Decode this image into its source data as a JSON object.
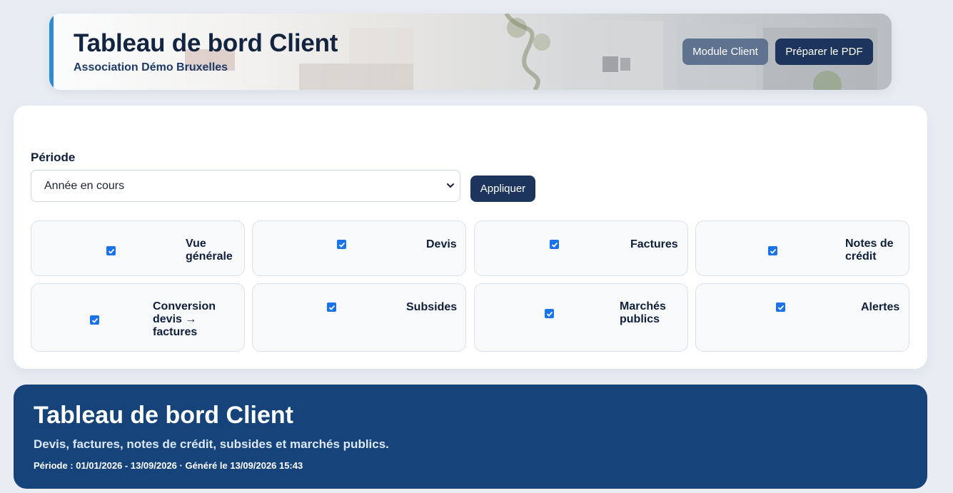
{
  "header": {
    "title": "Tableau de bord Client",
    "subtitle": "Association Démo Bruxelles",
    "buttons": {
      "client_label": "Module Client",
      "pdf_label": "Préparer le PDF"
    }
  },
  "filters": {
    "period_label": "Période",
    "period_selected": "Année en cours",
    "apply_label": "Appliquer",
    "sections": [
      {
        "label": "Vue\ngénérale",
        "checked": true
      },
      {
        "label": "Devis",
        "checked": true
      },
      {
        "label": "Factures",
        "checked": true
      },
      {
        "label": "Notes de\ncrédit",
        "checked": true
      },
      {
        "label": "Conversion\ndevis →\nfactures",
        "checked": true
      },
      {
        "label": "Subsides",
        "checked": true
      },
      {
        "label": "Marchés\npublics",
        "checked": true
      },
      {
        "label": "Alertes",
        "checked": true
      }
    ]
  },
  "banner": {
    "title": "Tableau de bord Client",
    "subtitle": "Devis, factures, notes de crédit, subsides et marchés publics.",
    "meta": "Période : 01/01/2026 - 13/09/2026 · Généré le 13/09/2026 15:43"
  },
  "colors": {
    "primary": "#1d355c",
    "secondary_button": "#5f7290",
    "accent": "#2a8bd6",
    "banner": "#16437a",
    "checkbox": "#1a73e8"
  },
  "icons": {
    "select": "chevron-down-icon",
    "checkbox": "checkmark-icon"
  }
}
